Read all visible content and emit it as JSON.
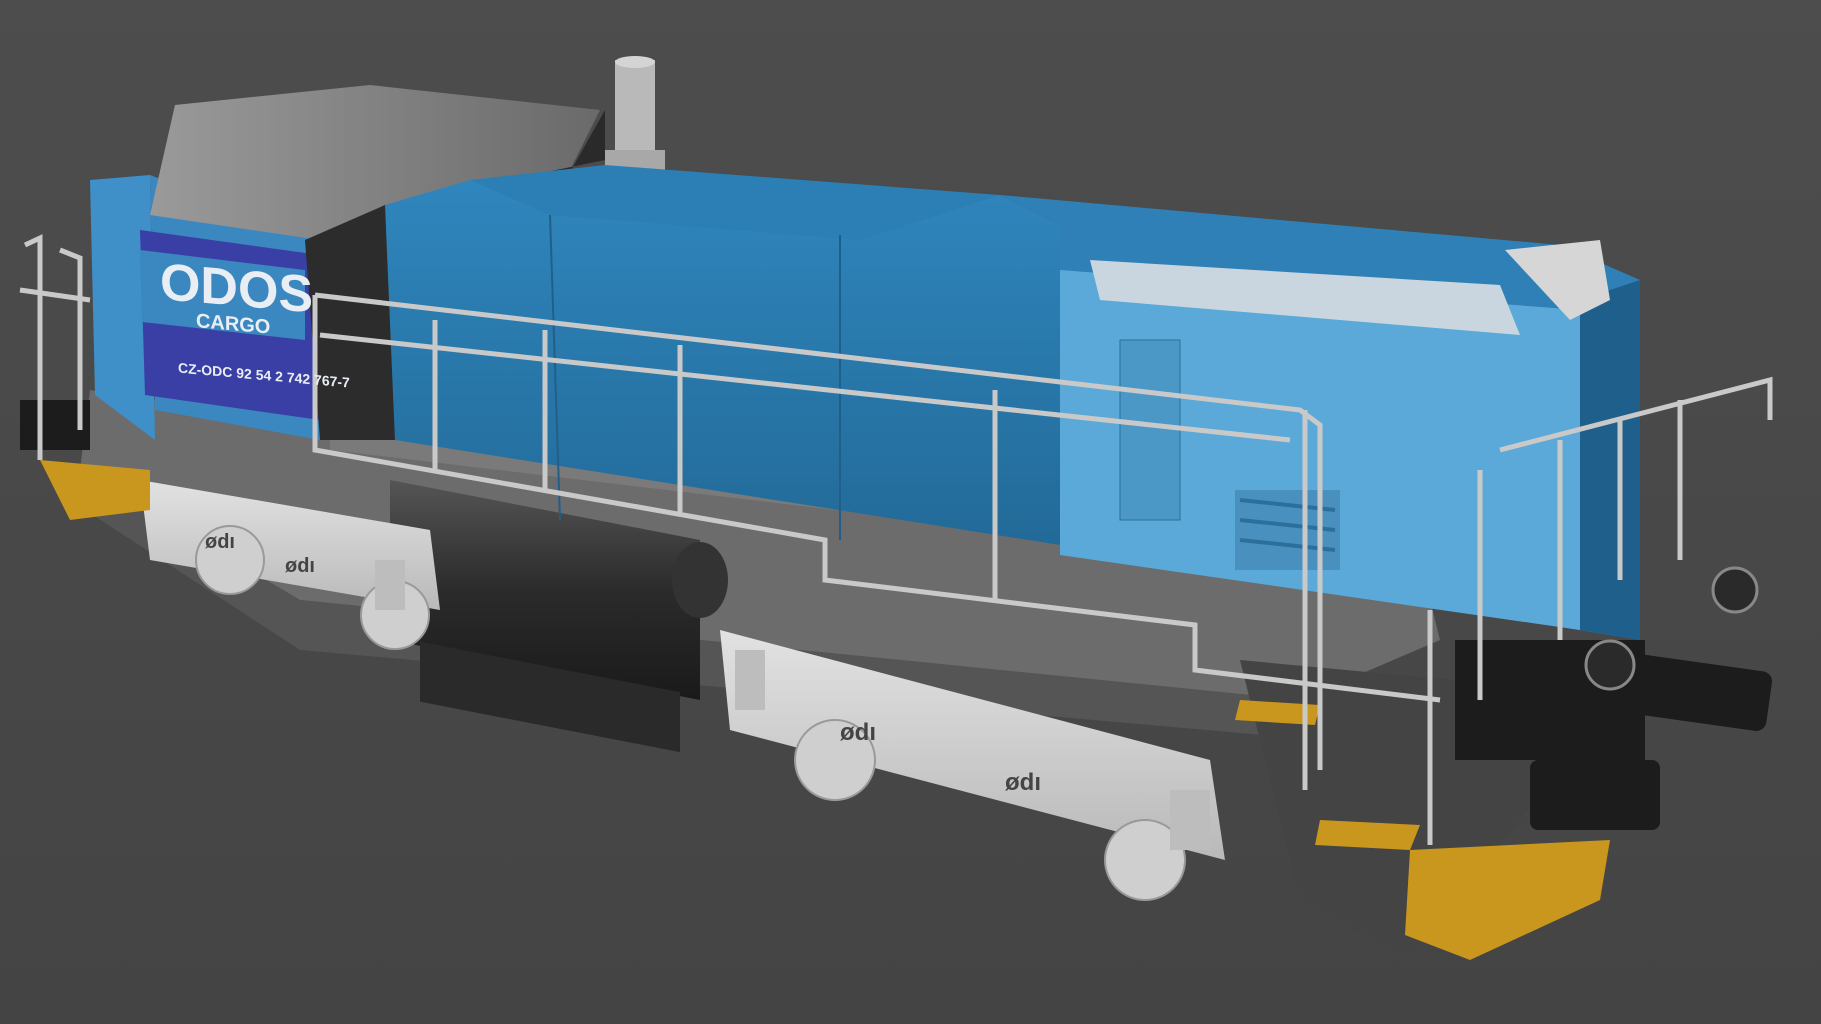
{
  "scene": {
    "subject": "locomotive-3d-render",
    "background_color": "#4a4a4a"
  },
  "livery": {
    "brand_line1": "ODOS",
    "brand_line2": "CARGO",
    "registration": "CZ-ODC 92 54 2 742 767-7"
  },
  "colors": {
    "body_blue": "#2f7fb3",
    "body_blue_dark": "#1f5f8c",
    "hood_blue_light": "#4a9bd0",
    "stripe_purple": "#3a3fa6",
    "cab_gray": "#8e8e8e",
    "roof_dark": "#2a2a2a",
    "frame_gray": "#6f6f6f",
    "bogie_light": "#d8d8d8",
    "railing": "#c9c9c9",
    "hazard_yellow": "#c9961e",
    "buffer_black": "#1c1c1c"
  }
}
